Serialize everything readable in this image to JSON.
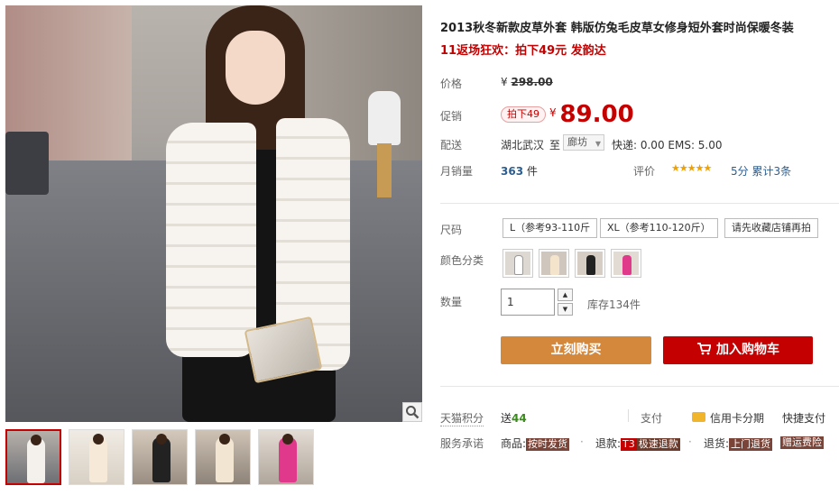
{
  "product": {
    "title": "2013秋冬新款皮草外套 韩版仿兔毛皮草女修身短外套时尚保暖冬装",
    "subtitle": "11返场狂欢：拍下49元 发韵达"
  },
  "price": {
    "label": "价格",
    "currency": "¥",
    "original": "298.00"
  },
  "promo": {
    "label": "促销",
    "badge": "拍下49",
    "currency": "¥",
    "price": "89.00"
  },
  "shipping": {
    "label": "配送",
    "from": "湖北武汉",
    "to_label": "至",
    "destination": "廊坊",
    "fee": "快递: 0.00 EMS: 5.00"
  },
  "sales": {
    "label": "月销量",
    "count": "363",
    "unit": "件",
    "rating_label": "评价",
    "stars": "★★★★★",
    "score": "5分",
    "reviews": "累计3条"
  },
  "size": {
    "label": "尺码",
    "options": [
      "L（参考93-110斤",
      "XL（参考110-120斤）",
      "请先收藏店铺再拍"
    ]
  },
  "color": {
    "label": "颜色分类"
  },
  "quantity": {
    "label": "数量",
    "value": "1",
    "stock": "库存134件"
  },
  "buttons": {
    "buy_now": "立刻购买",
    "add_to_cart": "加入购物车"
  },
  "tmall": {
    "points_label": "天猫积分",
    "points_prefix": "送",
    "points_value": "44",
    "pay_label": "支付",
    "card_installment": "信用卡分期",
    "quick_pay": "快捷支付"
  },
  "service": {
    "label": "服务承诺",
    "goods_prefix": "商品:",
    "goods_tag": "按时发货",
    "return_prefix": "退款:",
    "return_t3": "T3",
    "return_tag": "极速退款",
    "exchange_prefix": "退货:",
    "exchange_tag": "上门退货",
    "insurance_tag": "赠运费险"
  },
  "colors": {
    "accent_red": "#c40000",
    "buy_orange": "#d3883c",
    "link_blue": "#2c5d8f"
  }
}
